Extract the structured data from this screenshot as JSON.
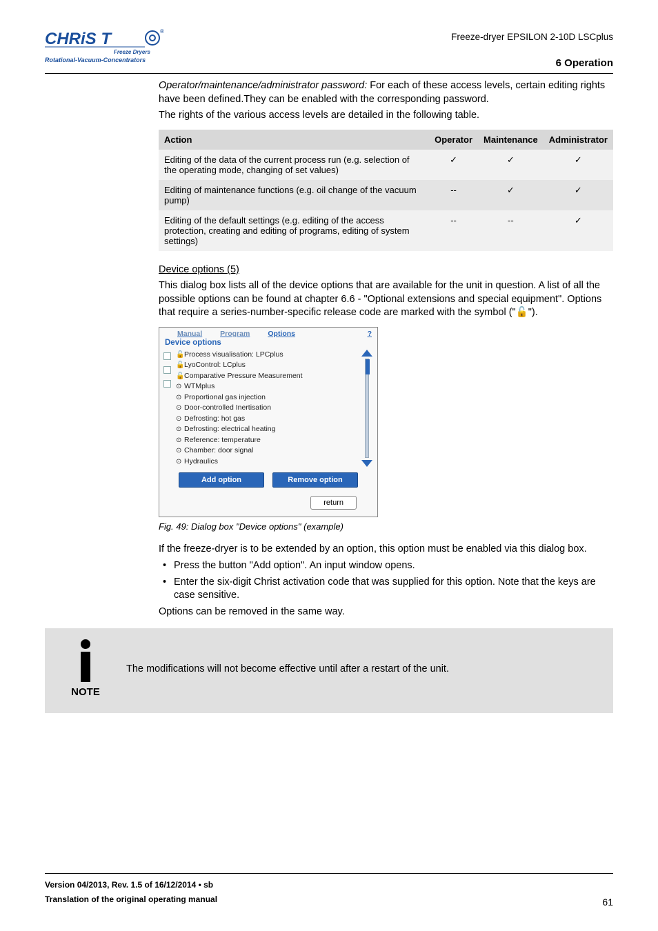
{
  "header": {
    "product": "Freeze-dryer EPSILON 2-10D LSCplus",
    "section_title": "6 Operation"
  },
  "logo": {
    "brand": "CHRIST",
    "sub1": "Freeze Dryers",
    "sub2": "Rotational-Vacuum-Concentrators"
  },
  "intro": {
    "p1_prefix": "Operator/maintenance/administrator password:",
    "p1_rest": " For each of these access levels, certain editing rights have been defined.They can be enabled with the corresponding password.",
    "p2": "The rights of the various access levels are detailed in the following table."
  },
  "table": {
    "headers": [
      "Action",
      "Operator",
      "Maintenance",
      "Administrator"
    ],
    "rows": [
      {
        "action": "Editing of the data of the current process run (e.g. selection of the operating mode, changing of set values)",
        "op": "✓",
        "mn": "✓",
        "ad": "✓"
      },
      {
        "action": "Editing of maintenance functions (e.g. oil change of the vacuum pump)",
        "op": "--",
        "mn": "✓",
        "ad": "✓"
      },
      {
        "action": "Editing of the default settings (e.g. editing of the access protection, creating and editing of programs, editing of system settings)",
        "op": "--",
        "mn": "--",
        "ad": "✓"
      }
    ]
  },
  "device": {
    "heading": "Device options (5)",
    "p1a": "This dialog box lists all of the device options that are available for the unit in question. A list of all the possible options can be found at chapter 6.6 - \"Optional extensions and special equipment\". Options that require a series-number-specific release code are marked with the symbol (\"",
    "p1b": "\").",
    "dialog": {
      "tabs": [
        "Manual",
        "Program",
        "Options"
      ],
      "help": "?",
      "title": "Device options",
      "options": [
        {
          "marker": "🔓",
          "label": "Process visualisation: LPCplus"
        },
        {
          "marker": "🔓",
          "label": "LyoControl: LCplus"
        },
        {
          "marker": "🔓",
          "label": "Comparative Pressure Measurement"
        },
        {
          "marker": "⊙",
          "label": "WTMplus"
        },
        {
          "marker": "⊙",
          "label": "Proportional gas injection"
        },
        {
          "marker": "⊙",
          "label": "Door-controlled Inertisation"
        },
        {
          "marker": "⊙",
          "label": "Defrosting: hot gas"
        },
        {
          "marker": "⊙",
          "label": "Defrosting: electrical heating"
        },
        {
          "marker": "⊙",
          "label": "Reference: temperature"
        },
        {
          "marker": "⊙",
          "label": "Chamber: door signal"
        },
        {
          "marker": "⊙",
          "label": "Hydraulics"
        }
      ],
      "add_btn": "Add option",
      "remove_btn": "Remove option",
      "return_btn": "return"
    },
    "figcap": "Fig. 49: Dialog box \"Device options\" (example)",
    "p2": "If the freeze-dryer is to be extended by an option, this option must be enabled via this dialog box.",
    "bullets": [
      "Press the button \"Add option\". An input window opens.",
      "Enter the six-digit Christ activation code that was supplied for this option. Note that the keys are case sensitive."
    ],
    "p3": "Options can be removed in the same way."
  },
  "note": {
    "label": "NOTE",
    "text": "The modifications will not become effective until after a restart of the unit."
  },
  "footer": {
    "line1": "Version 04/2013, Rev. 1.5 of 16/12/2014 • sb",
    "line2": "Translation of the original operating manual",
    "page": "61"
  },
  "symbol": {
    "unlock": "🔓"
  }
}
